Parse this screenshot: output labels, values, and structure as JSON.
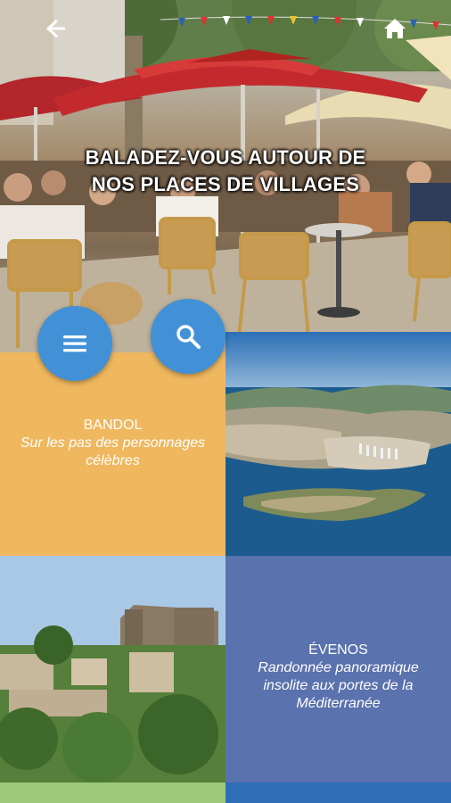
{
  "hero": {
    "title_line1": "BALADEZ-VOUS AUTOUR DE",
    "title_line2": "NOS PLACES DE VILLAGES",
    "icons": {
      "back": "back-arrow-icon",
      "home": "home-icon"
    }
  },
  "fabs": {
    "menu": "hamburger-menu-icon",
    "search": "search-icon"
  },
  "tiles": [
    {
      "title": "BANDOL",
      "subtitle": "Sur les pas des personnages célèbres"
    },
    {
      "title": "ÉVENOS",
      "subtitle": "Randonnée panoramique insolite aux portes de la Méditerranée"
    }
  ],
  "colors": {
    "fab": "#4291d6",
    "bandol_tile": "#efb75e",
    "evenos_tile": "#5a72ad",
    "strip_left": "#9dc87c",
    "strip_right": "#2f6fb8"
  }
}
